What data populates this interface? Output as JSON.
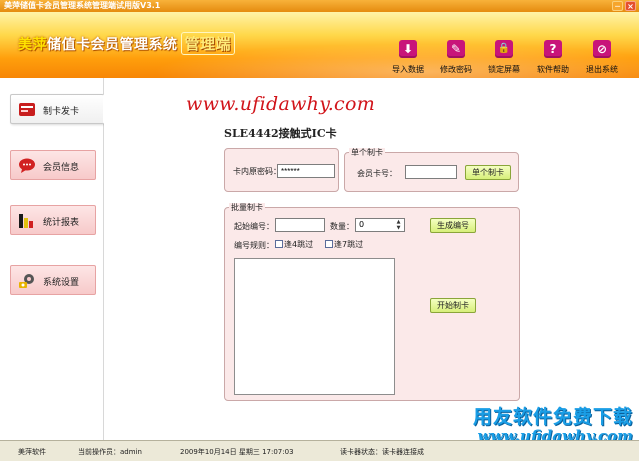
{
  "window": {
    "title": "美萍储值卡会员管理系统管理端试用版V3.1",
    "minimize_glyph": "─",
    "close_glyph": "×"
  },
  "header": {
    "brand": "美萍",
    "title_rest": "储值卡会员管理系统",
    "edition": "管理端"
  },
  "toolbar": {
    "icon_color": "#c8147a",
    "buttons": [
      {
        "label": "导入数据",
        "icon": "download-icon",
        "glyph": "⬇"
      },
      {
        "label": "修改密码",
        "icon": "pen-icon",
        "glyph": "✎"
      },
      {
        "label": "锁定屏幕",
        "icon": "lock-icon",
        "glyph": "🔒"
      },
      {
        "label": "软件帮助",
        "icon": "help-icon",
        "glyph": "?"
      },
      {
        "label": "退出系统",
        "icon": "exit-icon",
        "glyph": "⊘"
      }
    ]
  },
  "sidebar": {
    "items": [
      {
        "label": "制卡发卡",
        "icon": "card-maker-icon",
        "active": true
      },
      {
        "label": "会员信息",
        "icon": "chat-bubble-icon",
        "active": false
      },
      {
        "label": "统计报表",
        "icon": "bar-chart-icon",
        "active": false
      },
      {
        "label": "系统设置",
        "icon": "gear-icon",
        "active": false
      }
    ]
  },
  "main": {
    "watermark": "www.ufidawhy.com",
    "section_title": "SLE4442接触式IC卡",
    "card_password_label": "卡内原密码：",
    "card_password_value": "******",
    "single": {
      "legend": "单个制卡",
      "member_no_label": "会员卡号：",
      "member_no_value": "",
      "button_label": "单个制卡"
    },
    "batch": {
      "legend": "批量制卡",
      "start_no_label": "起始编号：",
      "start_no_value": "",
      "quantity_label": "数量：",
      "quantity_value": "0",
      "generate_label": "生成编号",
      "rule_label": "编号规则：",
      "skip4_label": "逢4跳过",
      "skip7_label": "逢7跳过",
      "start_label": "开始制卡"
    }
  },
  "bottom_logo": {
    "cn": "用友软件免费下载",
    "url": "www.ufidawhy.com"
  },
  "status": {
    "app": "美萍软件",
    "operator": "当前操作员：admin",
    "datetime": "2009年10月14日 星期三 17:07:03",
    "reader": "读卡器状态：读卡器连接成"
  }
}
